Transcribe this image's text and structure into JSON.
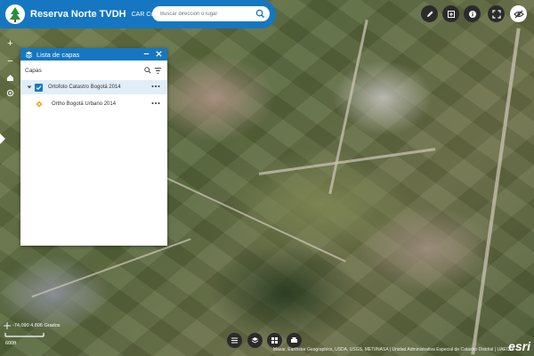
{
  "header": {
    "title": "Reserva Norte TVDH",
    "subtitle": "CAR Cundinamarca",
    "search_placeholder": "Buscar dirección o lugar",
    "logo_icon": "tree-logo-icon"
  },
  "toolbar_right": [
    {
      "name": "edit-button",
      "icon": "pencil-icon"
    },
    {
      "name": "layer-export-button",
      "icon": "export-icon"
    },
    {
      "name": "info-button",
      "icon": "info-icon"
    },
    {
      "name": "fullscreen-button",
      "icon": "fullscreen-icon"
    },
    {
      "name": "visibility-button",
      "icon": "eye-slash-icon"
    }
  ],
  "zoom_controls": [
    "+",
    "−"
  ],
  "layer_panel": {
    "title": "Lista de capas",
    "capas_label": "Capas",
    "layers": [
      {
        "label": "Ortofoto Catastro Bogotá 2014",
        "checked": true
      },
      {
        "label": "Ortho Bogotá Urbano 2014"
      }
    ]
  },
  "bottom_toolbar": [
    {
      "name": "layer-list-button",
      "icon": "list-icon"
    },
    {
      "name": "basemap-button",
      "icon": "layers-icon"
    },
    {
      "name": "basemap-gallery-button",
      "icon": "grid-icon"
    },
    {
      "name": "print-button",
      "icon": "print-icon"
    }
  ],
  "map": {
    "coords": "-74,090 4,806 Grados",
    "scale": "600ft",
    "attribution": "Maxar, Earthstar Geographics, USDA, USGS, METI/NASA | Unidad Administrativa Especial de Catastro Distrital | UAECD",
    "brand": "esri"
  },
  "colors": {
    "accent": "#1577c2",
    "dark_button": "#2b2b2b"
  }
}
